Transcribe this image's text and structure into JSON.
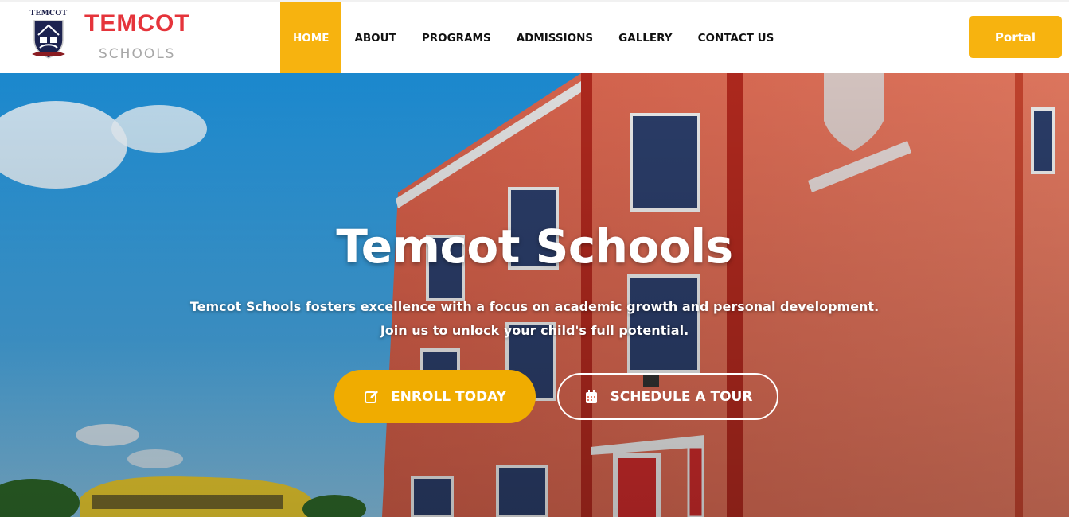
{
  "brand": {
    "crest_text": "TEMCOT",
    "name": "TEMCOT",
    "subtitle": "SCHOOLS"
  },
  "nav": {
    "items": [
      {
        "label": "HOME",
        "active": true
      },
      {
        "label": "ABOUT",
        "active": false
      },
      {
        "label": "PROGRAMS",
        "active": false
      },
      {
        "label": "ADMISSIONS",
        "active": false
      },
      {
        "label": "GALLERY",
        "active": false
      },
      {
        "label": "CONTACT US",
        "active": false
      }
    ],
    "portal_label": "Portal"
  },
  "hero": {
    "title": "Temcot Schools",
    "text_line1": "Temcot Schools fosters excellence with a focus on academic growth and personal development.",
    "text_line2": "Join us to unlock your child's full potential.",
    "enroll_label": "ENROLL TODAY",
    "enroll_icon": "edit-icon",
    "tour_label": "SCHEDULE A TOUR",
    "tour_icon": "calendar-icon"
  },
  "colors": {
    "accent": "#f7b30f",
    "brand_red": "#e5343b",
    "brand_gray": "#a7a7a7"
  }
}
